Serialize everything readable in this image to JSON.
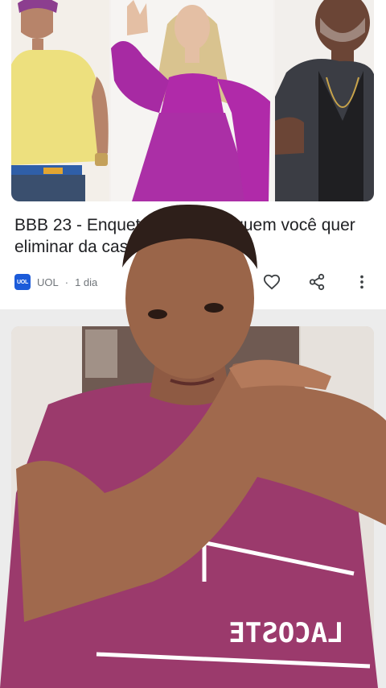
{
  "article": {
    "headline": "BBB 23 - Enquete: vote para quem você quer eliminar da casa",
    "source_logo_text": "UOL",
    "source": "UOL",
    "age": "1 dia",
    "actions": [
      "like",
      "share",
      "more"
    ]
  },
  "icons": {
    "like": "heart-outline-icon",
    "share": "share-icon",
    "more": "more-vertical-icon"
  },
  "colors": {
    "shirt": "#9b3a6c",
    "accent_purple": "#a92fa6",
    "yellow_top": "#ede07e",
    "logo_blue": "#1c5bd9"
  },
  "overlay": {
    "shirt_text": "LACOSTE"
  }
}
